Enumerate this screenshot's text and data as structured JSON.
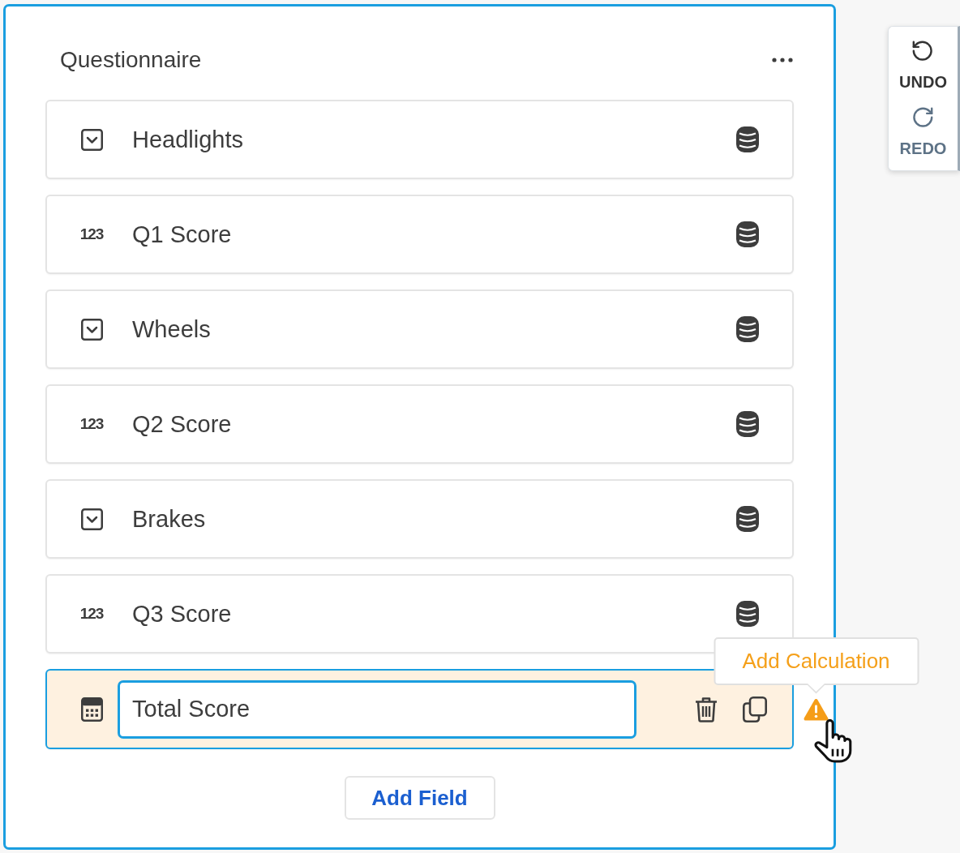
{
  "form": {
    "title": "Questionnaire"
  },
  "fields": [
    {
      "kind": "dropdown",
      "label": "Headlights",
      "selected": false
    },
    {
      "kind": "number",
      "type_glyph": "123",
      "label": "Q1 Score",
      "selected": false
    },
    {
      "kind": "dropdown",
      "label": "Wheels",
      "selected": false
    },
    {
      "kind": "number",
      "type_glyph": "123",
      "label": "Q2 Score",
      "selected": false
    },
    {
      "kind": "dropdown",
      "label": "Brakes",
      "selected": false
    },
    {
      "kind": "number",
      "type_glyph": "123",
      "label": "Q3 Score",
      "selected": false
    },
    {
      "kind": "calculation",
      "label": "Total Score",
      "selected": true,
      "warning": {
        "tooltip": "Add Calculation"
      }
    }
  ],
  "add_button": "Add Field",
  "history": [
    {
      "kind": "undo",
      "label": "UNDO",
      "disabled": false
    },
    {
      "kind": "redo",
      "label": "REDO",
      "disabled": true
    }
  ]
}
